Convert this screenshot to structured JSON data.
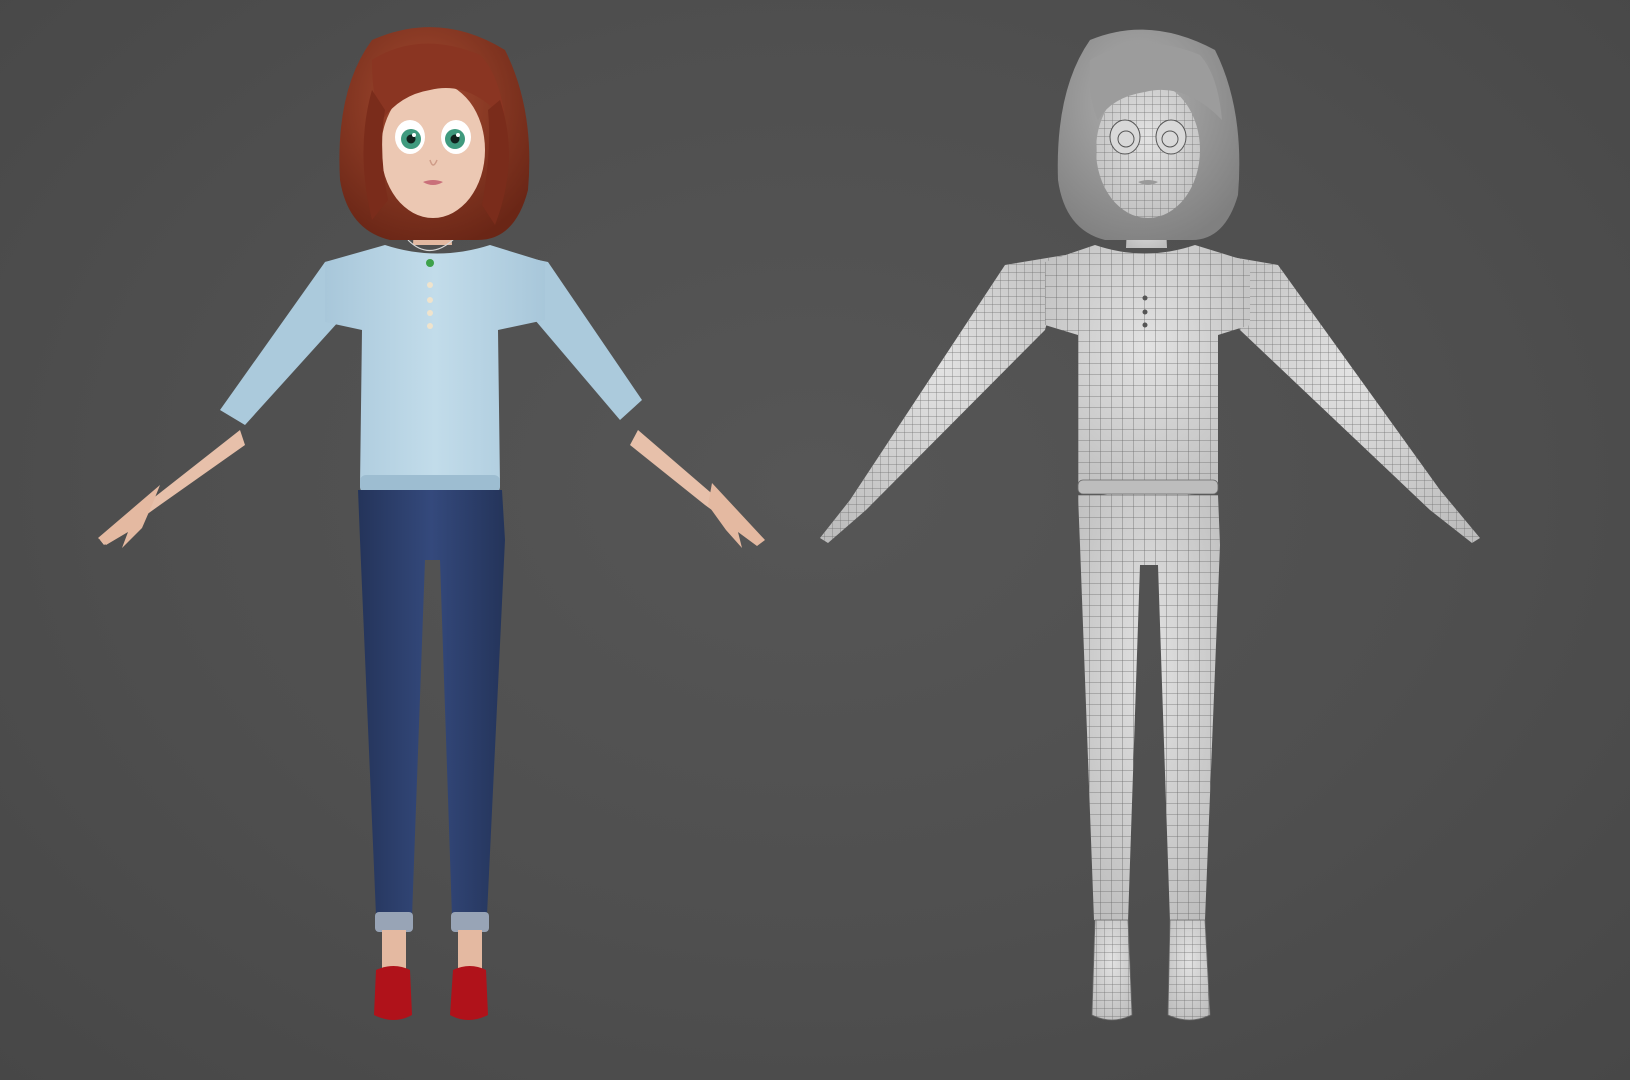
{
  "scene": {
    "background_color": "#4f4f4f",
    "figures": [
      {
        "id": "shaded-render",
        "render_mode": "textured",
        "colors": {
          "hair": "#7a2e1c",
          "hair_highlight": "#a44a30",
          "skin": "#e9c3ad",
          "skin_shadow": "#d8a993",
          "eyes": "#3f9a7e",
          "lips": "#c9707a",
          "shirt": "#b9d6e6",
          "shirt_shadow": "#9fbfd2",
          "jeans": "#2a3c63",
          "jeans_highlight": "#3b5185",
          "cuff": "#9aa6b8",
          "shoes": "#b0121a",
          "necklace_pendant": "#3ea14a",
          "buttons": "#e8dcc4"
        }
      },
      {
        "id": "wireframe-render",
        "render_mode": "clay-wireframe",
        "colors": {
          "clay": "#d7d7d7",
          "clay_shadow": "#b8b8b8",
          "hair": "#9a9a9a",
          "wire": "#6a6a6a"
        }
      }
    ]
  }
}
